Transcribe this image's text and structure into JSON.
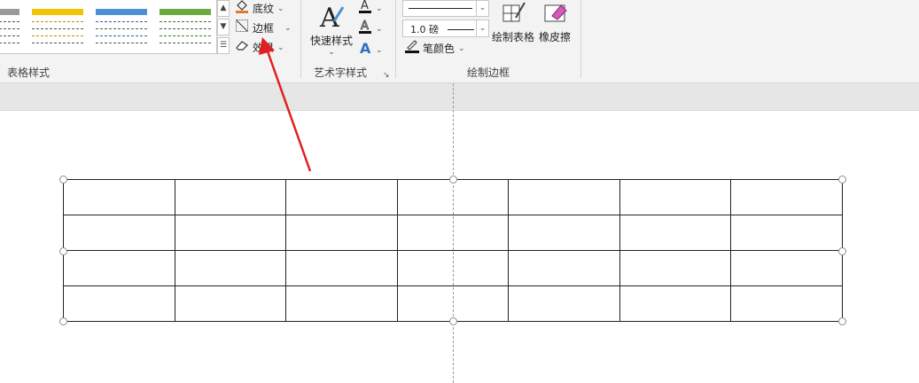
{
  "ribbon": {
    "table_styles": {
      "label": "表格样式",
      "thumb_colors": [
        "#f2c300",
        "#4d8fd6",
        "#6aab3f"
      ]
    },
    "shading_label": "底纹",
    "borders_label": "边框",
    "effects_label": "效果",
    "wordart": {
      "quick_styles_label": "快速样式",
      "group_label": "艺术字样式"
    },
    "draw_borders": {
      "pen_weight": "1.0 磅",
      "pen_color_label": "笔颜色",
      "draw_table_label": "绘制表格",
      "eraser_label": "橡皮擦",
      "group_label": "绘制边框"
    }
  },
  "table": {
    "rows": 4,
    "cols": 7,
    "cells": [
      [
        "",
        "",
        "",
        "",
        "",
        "",
        ""
      ],
      [
        "",
        "",
        "",
        "",
        "",
        "",
        ""
      ],
      [
        "",
        "",
        "",
        "",
        "",
        "",
        ""
      ],
      [
        "",
        "",
        "",
        "",
        "",
        "",
        ""
      ]
    ]
  },
  "annotation": {
    "arrow_color": "#e02020"
  }
}
